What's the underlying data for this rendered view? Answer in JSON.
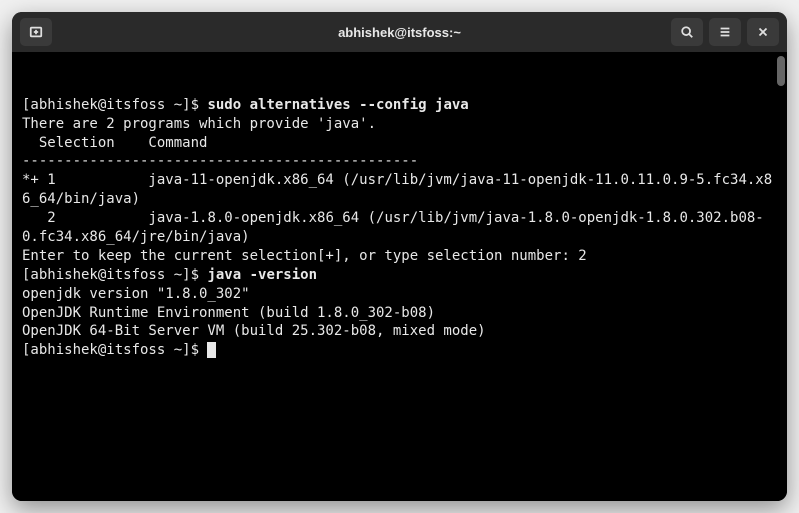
{
  "titlebar": {
    "title": "abhishek@itsfoss:~"
  },
  "terminal": {
    "l1_prompt": "[abhishek@itsfoss ~]$ ",
    "l1_cmd": "sudo alternatives --config java",
    "l2": "",
    "l3": "There are 2 programs which provide 'java'.",
    "l4": "",
    "l5": "  Selection    Command",
    "l6": "-----------------------------------------------",
    "l7": "*+ 1           java-11-openjdk.x86_64 (/usr/lib/jvm/java-11-openjdk-11.0.11.0.9-5.fc34.x86_64/bin/java)",
    "l8": "   2           java-1.8.0-openjdk.x86_64 (/usr/lib/jvm/java-1.8.0-openjdk-1.8.0.302.b08-0.fc34.x86_64/jre/bin/java)",
    "l9": "",
    "l10": "Enter to keep the current selection[+], or type selection number: 2",
    "l11_prompt": "[abhishek@itsfoss ~]$ ",
    "l11_cmd": "java -version",
    "l12": "openjdk version \"1.8.0_302\"",
    "l13": "OpenJDK Runtime Environment (build 1.8.0_302-b08)",
    "l14": "OpenJDK 64-Bit Server VM (build 25.302-b08, mixed mode)",
    "l15_prompt": "[abhishek@itsfoss ~]$ "
  }
}
